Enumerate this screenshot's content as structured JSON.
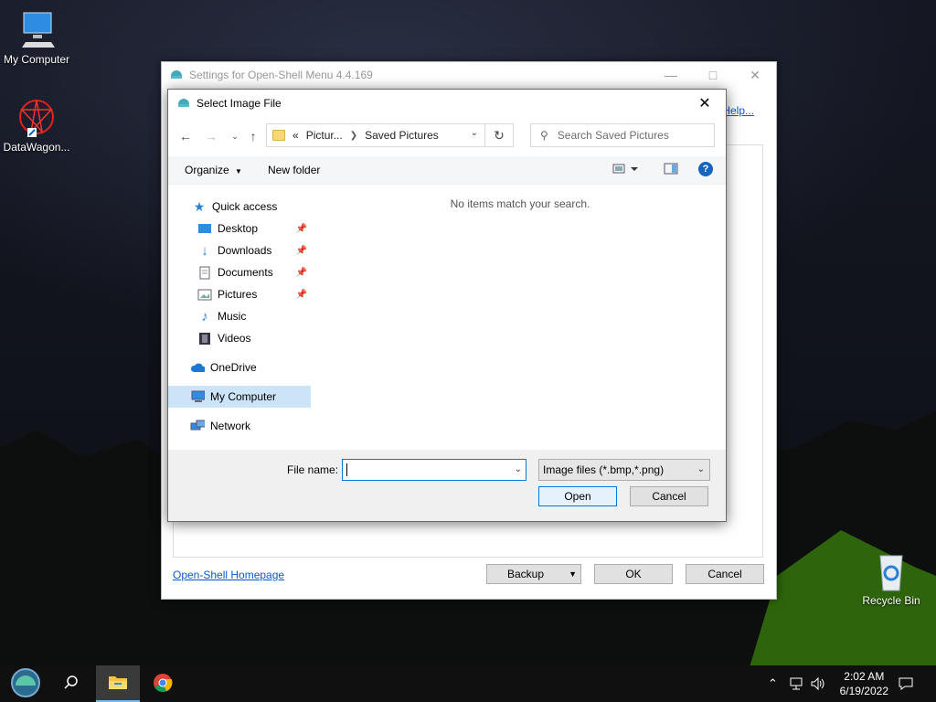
{
  "desktop": {
    "icons": [
      {
        "label": "My Computer"
      },
      {
        "label": "DataWagon..."
      },
      {
        "label": "Recycle Bin"
      }
    ]
  },
  "settings_window": {
    "title": "Settings for Open-Shell Menu 4.4.169",
    "help_link": "Help...",
    "homepage_link": "Open-Shell Homepage",
    "backup_label": "Backup",
    "ok_label": "OK",
    "cancel_label": "Cancel"
  },
  "dialog": {
    "title": "Select Image File",
    "address": {
      "crumb_prefix": "«",
      "crumb_1": "Pictur...",
      "crumb_2": "Saved Pictures"
    },
    "search_placeholder": "Search Saved Pictures",
    "toolbar": {
      "organize": "Organize",
      "new_folder": "New folder"
    },
    "nav": {
      "quick_access": "Quick access",
      "items": [
        {
          "label": "Desktop",
          "pinned": true
        },
        {
          "label": "Downloads",
          "pinned": true
        },
        {
          "label": "Documents",
          "pinned": true
        },
        {
          "label": "Pictures",
          "pinned": true
        },
        {
          "label": "Music",
          "pinned": false
        },
        {
          "label": "Videos",
          "pinned": false
        }
      ],
      "onedrive": "OneDrive",
      "my_computer": "My Computer",
      "network": "Network"
    },
    "empty_message": "No items match your search.",
    "file_name_label": "File name:",
    "file_name_value": "",
    "file_type": "Image files (*.bmp,*.png)",
    "open_label": "Open",
    "cancel_label": "Cancel"
  },
  "taskbar": {
    "time": "2:02 AM",
    "date": "6/19/2022"
  },
  "colors": {
    "accent": "#0078d7",
    "selection": "#cce4f7",
    "link": "#0b57d0"
  }
}
